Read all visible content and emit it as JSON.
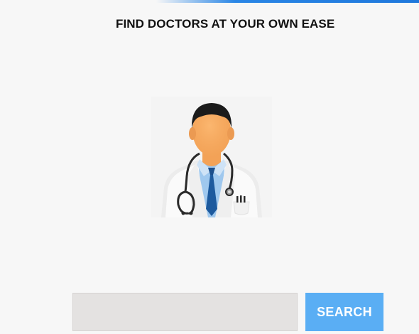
{
  "header": {
    "title": "FIND DOCTORS AT YOUR OWN EASE"
  },
  "hero": {
    "illustration": "doctor-illustration"
  },
  "search": {
    "placeholder": "",
    "value": "",
    "button_label": "SEARCH"
  },
  "colors": {
    "accent": "#1f78dc",
    "button": "#5aaef4",
    "input_background": "#e4e2e1",
    "page_background": "#f7f7f7"
  }
}
